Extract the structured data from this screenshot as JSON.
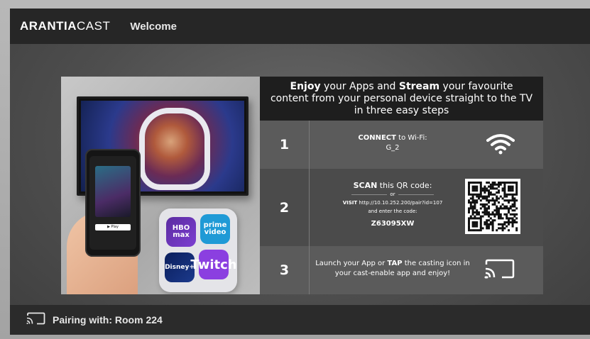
{
  "header": {
    "brand_bold": "ARANTIA",
    "brand_light": "CAST",
    "title": "Welcome"
  },
  "intro": {
    "w1": "Enjoy",
    "t1": " your Apps and ",
    "w2": "Stream",
    "t2": " your favourite content from your personal device straight to the TV in three easy steps"
  },
  "steps": [
    {
      "number": "1",
      "label_bold": "CONNECT",
      "label_rest": " to Wi-Fi:",
      "value": "G_2",
      "icon": "wifi-icon"
    },
    {
      "number": "2",
      "label_bold": "SCAN",
      "label_rest": " this QR code:",
      "or": "or",
      "visit_bold": "VISIT",
      "visit_url": " http://10.10.252.200/pair?id=107",
      "visit_rest": "and enter the code:",
      "code": "Z63095XW",
      "icon": "qr-code"
    },
    {
      "number": "3",
      "text_a": "Launch your App or ",
      "text_bold": "TAP",
      "text_b": " the casting icon in your cast-enable app and enjoy!",
      "icon": "cast-icon"
    }
  ],
  "hero": {
    "apps": [
      "HBO max",
      "prime video",
      "Disney+",
      "Twitch"
    ],
    "phone_button": "▶ Play"
  },
  "footer": {
    "pairing": "Pairing with: Room 224",
    "icon": "cast-icon"
  },
  "colors": {
    "header_bg": "#262626",
    "intro_bg": "#1e1e1e",
    "step_bg": "#5b5b5b",
    "step_alt_bg": "#4b4b4b"
  }
}
